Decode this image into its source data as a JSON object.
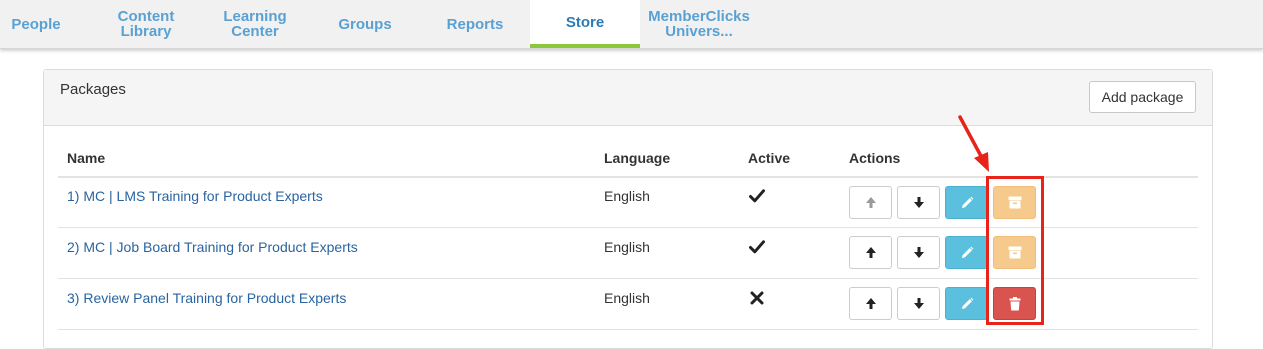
{
  "nav": {
    "tabs": [
      {
        "label": "People",
        "active": false
      },
      {
        "label": "Content\nLibrary",
        "active": false
      },
      {
        "label": "Learning\nCenter",
        "active": false
      },
      {
        "label": "Groups",
        "active": false
      },
      {
        "label": "Reports",
        "active": false
      },
      {
        "label": "Store",
        "active": true
      },
      {
        "label": "MemberClicks\nUnivers...",
        "active": false
      }
    ]
  },
  "panel": {
    "title": "Packages",
    "add_button_label": "Add package"
  },
  "table": {
    "columns": [
      "Name",
      "Language",
      "Active",
      "Actions"
    ],
    "rows": [
      {
        "name": "1) MC | LMS Training for Product Experts",
        "language": "English",
        "active": true,
        "up_enabled": false,
        "last_action": "archive"
      },
      {
        "name": "2) MC | Job Board Training for Product Experts",
        "language": "English",
        "active": true,
        "up_enabled": true,
        "last_action": "archive"
      },
      {
        "name": "3) Review Panel Training for Product Experts",
        "language": "English",
        "active": false,
        "up_enabled": true,
        "last_action": "delete"
      }
    ]
  },
  "icons": {
    "move_up": "arrow-up-icon",
    "move_down": "arrow-down-icon",
    "edit": "pencil-icon",
    "archive": "archive-box-icon",
    "delete": "trash-icon",
    "active_yes": "checkmark-icon",
    "active_no": "cross-icon"
  },
  "colors": {
    "nav_text": "#5aa1d3",
    "active_tab_underline": "#8cc63f",
    "link": "#2a64a0",
    "edit_button": "#5bc0de",
    "archive_button": "#f6c98c",
    "delete_button": "#d9534f",
    "annotation": "#e8241a"
  }
}
